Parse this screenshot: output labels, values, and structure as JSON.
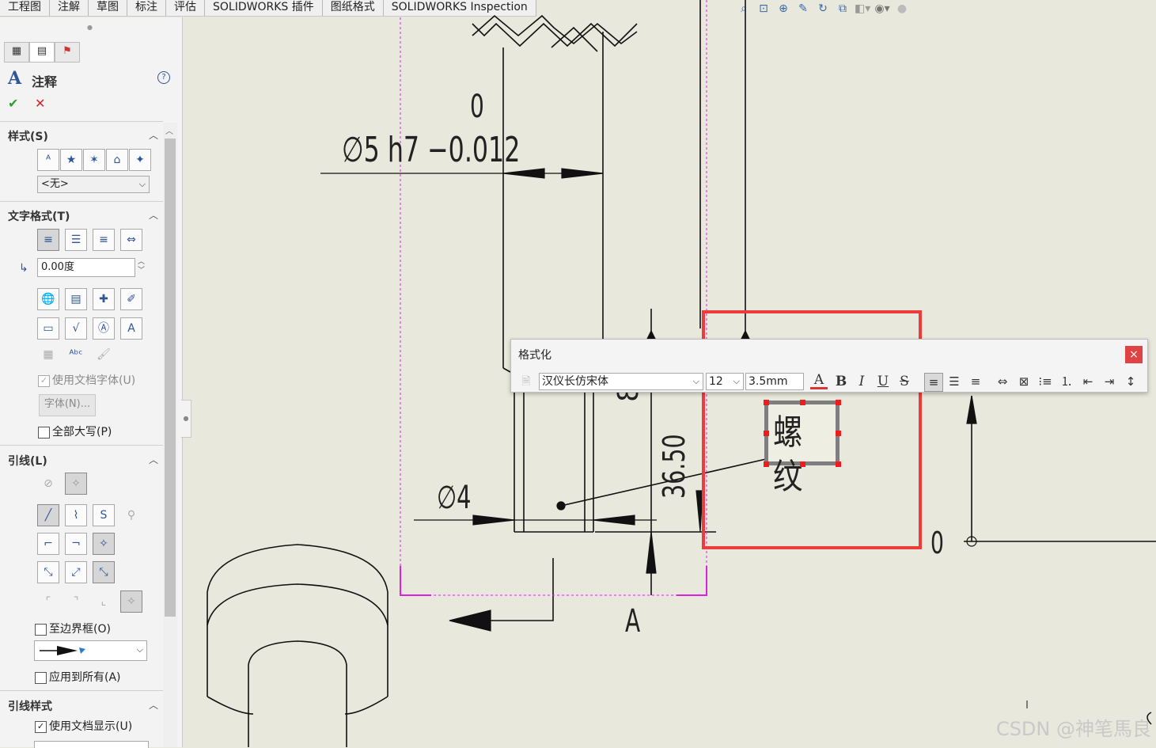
{
  "tabs": [
    "工程图",
    "注解",
    "草图",
    "标注",
    "评估",
    "SOLIDWORKS 插件",
    "图纸格式",
    "SOLIDWORKS Inspection"
  ],
  "view_icons": [
    "zoom-to-fit-icon",
    "zoom-area-icon",
    "zoom-in-icon",
    "pan-icon",
    "rotate-icon",
    "view-3d-icon",
    "display-style-icon",
    "hide-show-icon",
    "appearance-icon"
  ],
  "panel": {
    "title": "注释",
    "help": "?",
    "ok": "✔",
    "cancel": "✕",
    "style_section": "样式(S)",
    "style_select": "<无>",
    "text_format_section": "文字格式(T)",
    "angle_value": "0.00度",
    "use_doc_font": "使用文档字体(U)",
    "font_button": "字体(N)...",
    "all_caps": "全部大写(P)",
    "leader_section": "引线(L)",
    "to_border": "至边界框(O)",
    "apply_all": "应用到所有(A)",
    "leader_style_section": "引线样式",
    "use_doc_display": "使用文档显示(U)"
  },
  "drawing": {
    "tolerance_upper": "0",
    "dim_main": "∅5 h7 −0.012",
    "dim_phi4": "∅4",
    "dim_vertical": "36.50",
    "dim_partial": "8",
    "section_label": "A",
    "zero_right": "0",
    "note_text": "螺纹"
  },
  "format_dialog": {
    "title": "格式化",
    "close": "×",
    "font_name": "汉仪长仿宋体",
    "font_size": "12",
    "height": "3.5mm",
    "bold": "B",
    "italic": "I",
    "underline": "U",
    "strike": "S"
  },
  "watermark": "CSDN @神笔馬良",
  "colors": {
    "highlight": "#ee3b3b",
    "magenta": "#e020e0",
    "handle": "#ee1c1c"
  }
}
